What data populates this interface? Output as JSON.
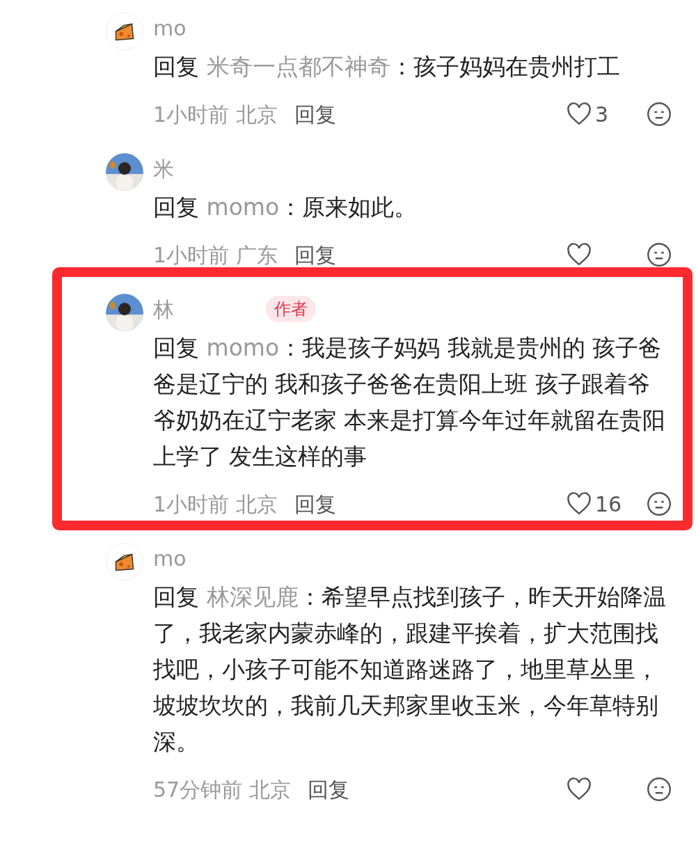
{
  "comments": [
    {
      "avatar": {
        "kind": "cheese"
      },
      "author": "mo",
      "reply_prefix": "回复",
      "reply_to": "米奇一点都不神奇",
      "text": "：孩子妈妈在贵州打工",
      "time": "1小时前",
      "location": "北京",
      "reply_label": "回复",
      "likes": "3",
      "circled": false
    },
    {
      "author": "米",
      "reply_prefix": "回复",
      "reply_to": "momo",
      "text": "：原来如此。",
      "time": "1小时前",
      "location": "广东",
      "reply_label": "回复",
      "circled": false
    },
    {
      "author": "林",
      "badge": "作者",
      "reply_prefix": "回复",
      "reply_to": "momo",
      "text": "：我是孩子妈妈 我就是贵州的 孩子爸爸是辽宁的 我和孩子爸爸在贵阳上班 孩子跟着爷爷奶奶在辽宁老家 本来是打算今年过年就留在贵阳上学了 发生这样的事",
      "time": "1小时前",
      "location": "北京",
      "reply_label": "回复",
      "likes": "16",
      "circled": true
    },
    {
      "avatar": {
        "kind": "cheese"
      },
      "author": "mo",
      "reply_prefix": "回复",
      "reply_to": "林深见鹿",
      "text": "：希望早点找到孩子，昨天开始降温了，我老家内蒙赤峰的，跟建平挨着，扩大范围找找吧，小孩子可能不知道路迷路了，地里草丛里，坡坡坎坎的，我前几天邦家里收玉米，今年草特别深。",
      "time": "57分钟前",
      "location": "北京",
      "reply_label": "回复",
      "circled": false
    }
  ]
}
